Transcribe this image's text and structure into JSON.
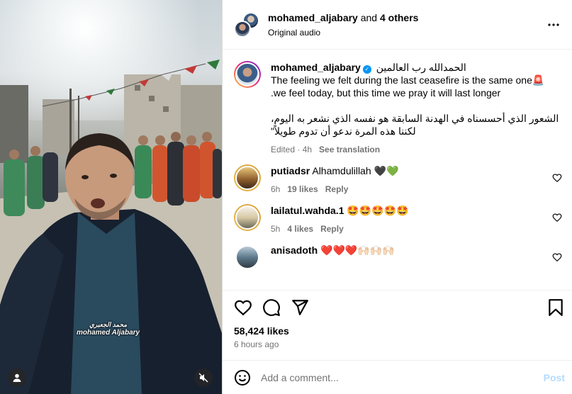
{
  "header": {
    "username": "mohamed_aljabary",
    "and_text": " and ",
    "others": "4 others",
    "audio": "Original audio"
  },
  "caption": {
    "username": "mohamed_aljabary",
    "arabic_title": "الحمدالله رب العالمين",
    "line1": "The feeling we felt during the last ceasefire is the same one🚨",
    "line2": ".we feel today, but this time we pray it will last longer",
    "arabic1": "الشعور الذي أحسسناه في الهدنة السابقة هو نفسه الذي نشعر به اليوم،",
    "arabic2": "لكننا هذه المرة ندعو أن تدوم طويلاً\"",
    "edited": "Edited · 4h",
    "see_translation": "See translation"
  },
  "comments": [
    {
      "username": "putiadsr",
      "text": "Alhamdulillah 🖤💚",
      "time": "6h",
      "likes": "19 likes",
      "reply": "Reply"
    },
    {
      "username": "lailatul.wahda.1",
      "text": "🤩🤩🤩🤩🤩",
      "time": "5h",
      "likes": "4 likes",
      "reply": "Reply"
    },
    {
      "username": "anisadoth",
      "text": "❤️❤️❤️🙌🏻🙌🏻🙌🏻"
    }
  ],
  "post": {
    "likes": "58,424 likes",
    "time_ago": "6 hours ago"
  },
  "composer": {
    "placeholder": "Add a comment...",
    "post_label": "Post"
  },
  "media": {
    "watermark_ar": "محمد الجعبري",
    "watermark_en": "mohamed Aljabary"
  },
  "icons": {
    "more": "more-options-icon",
    "like": "heart-icon",
    "comment": "comment-icon",
    "share": "share-icon",
    "save": "bookmark-icon",
    "emoji": "emoji-icon",
    "mute": "muted-speaker-icon",
    "user_tag": "user-tag-icon"
  },
  "colors": {
    "link_blue": "#0095f6",
    "post_disabled": "#b3dbff",
    "secondary_text": "#737373"
  }
}
